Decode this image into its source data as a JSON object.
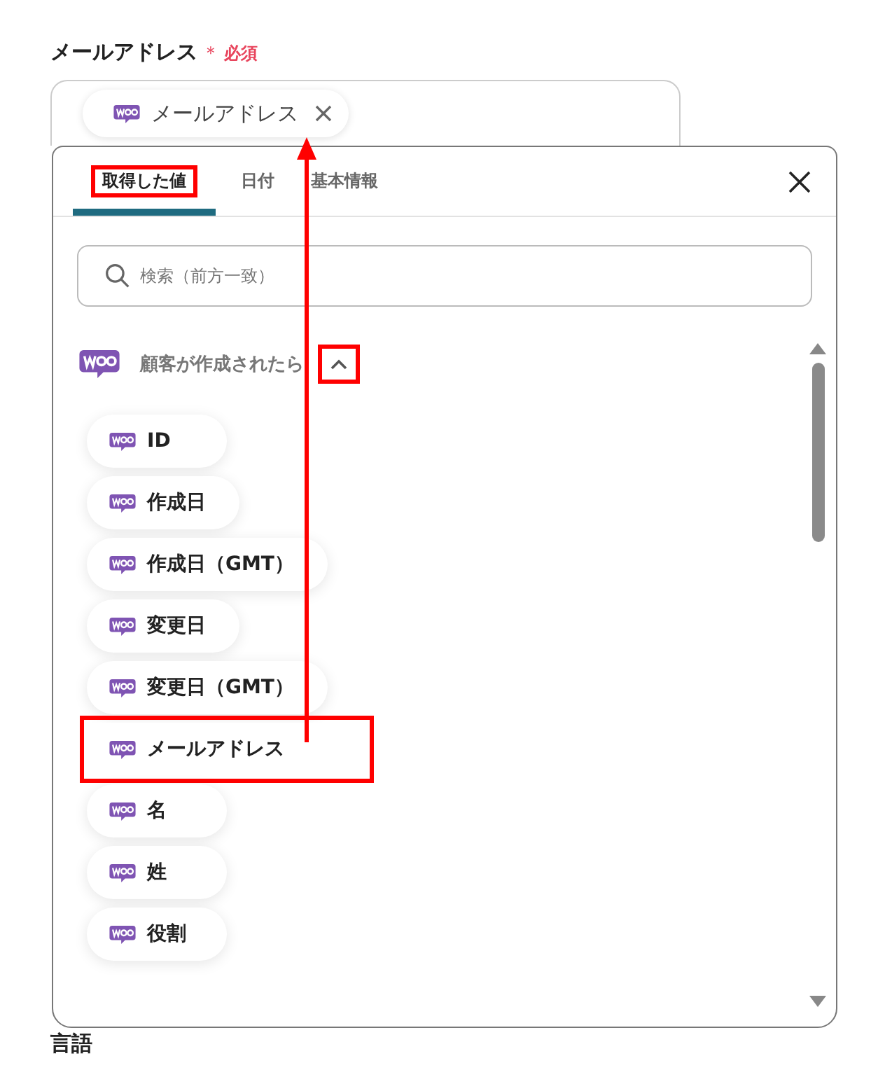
{
  "field": {
    "label": "メールアドレス",
    "required_mark": "＊",
    "required_text": "必須",
    "chips": [
      {
        "label": "メールアドレス"
      }
    ]
  },
  "picker": {
    "tabs": [
      {
        "label": "取得した値",
        "selected": true,
        "highlighted": true
      },
      {
        "label": "日付",
        "selected": false,
        "highlighted": false
      },
      {
        "label": "基本情報",
        "selected": false,
        "highlighted": false
      }
    ],
    "search": {
      "placeholder": "検索（前方一致）"
    },
    "group": {
      "title": "顧客が作成されたら",
      "expanded": true,
      "toggle_highlighted": true,
      "items": [
        {
          "label": "ID",
          "highlighted": false
        },
        {
          "label": "作成日",
          "highlighted": false
        },
        {
          "label": "作成日（GMT）",
          "highlighted": false
        },
        {
          "label": "変更日",
          "highlighted": false
        },
        {
          "label": "変更日（GMT）",
          "highlighted": false
        },
        {
          "label": "メールアドレス",
          "highlighted": true
        },
        {
          "label": "名",
          "highlighted": false
        },
        {
          "label": "姓",
          "highlighted": false
        },
        {
          "label": "役割",
          "highlighted": false
        }
      ]
    }
  },
  "next_field": {
    "label": "言語"
  }
}
